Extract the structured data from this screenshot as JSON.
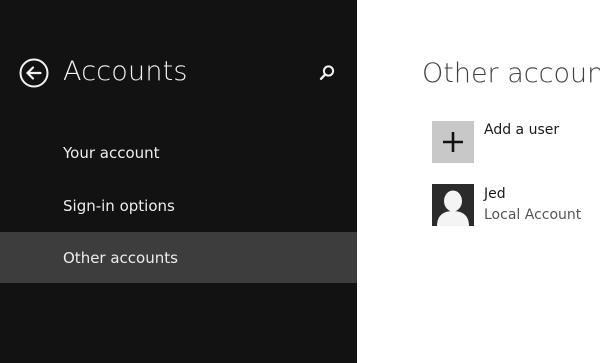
{
  "sidebar": {
    "title": "Accounts",
    "back_icon": "back-arrow-circle-icon",
    "search_icon": "search-icon",
    "items": [
      {
        "label": "Your account"
      },
      {
        "label": "Sign-in options"
      },
      {
        "label": "Other accounts",
        "selected": true
      }
    ]
  },
  "main": {
    "title": "Other accounts",
    "add_user": {
      "label": "Add a user",
      "icon": "plus-icon"
    },
    "users": [
      {
        "name": "Jed",
        "type": "Local Account",
        "icon": "user-avatar-icon"
      }
    ]
  },
  "colors": {
    "sidebar_bg": "#121212",
    "selected_bg": "#3d3d3d",
    "add_tile_bg": "#c8c8c8",
    "avatar_bg": "#2b2b2b"
  }
}
